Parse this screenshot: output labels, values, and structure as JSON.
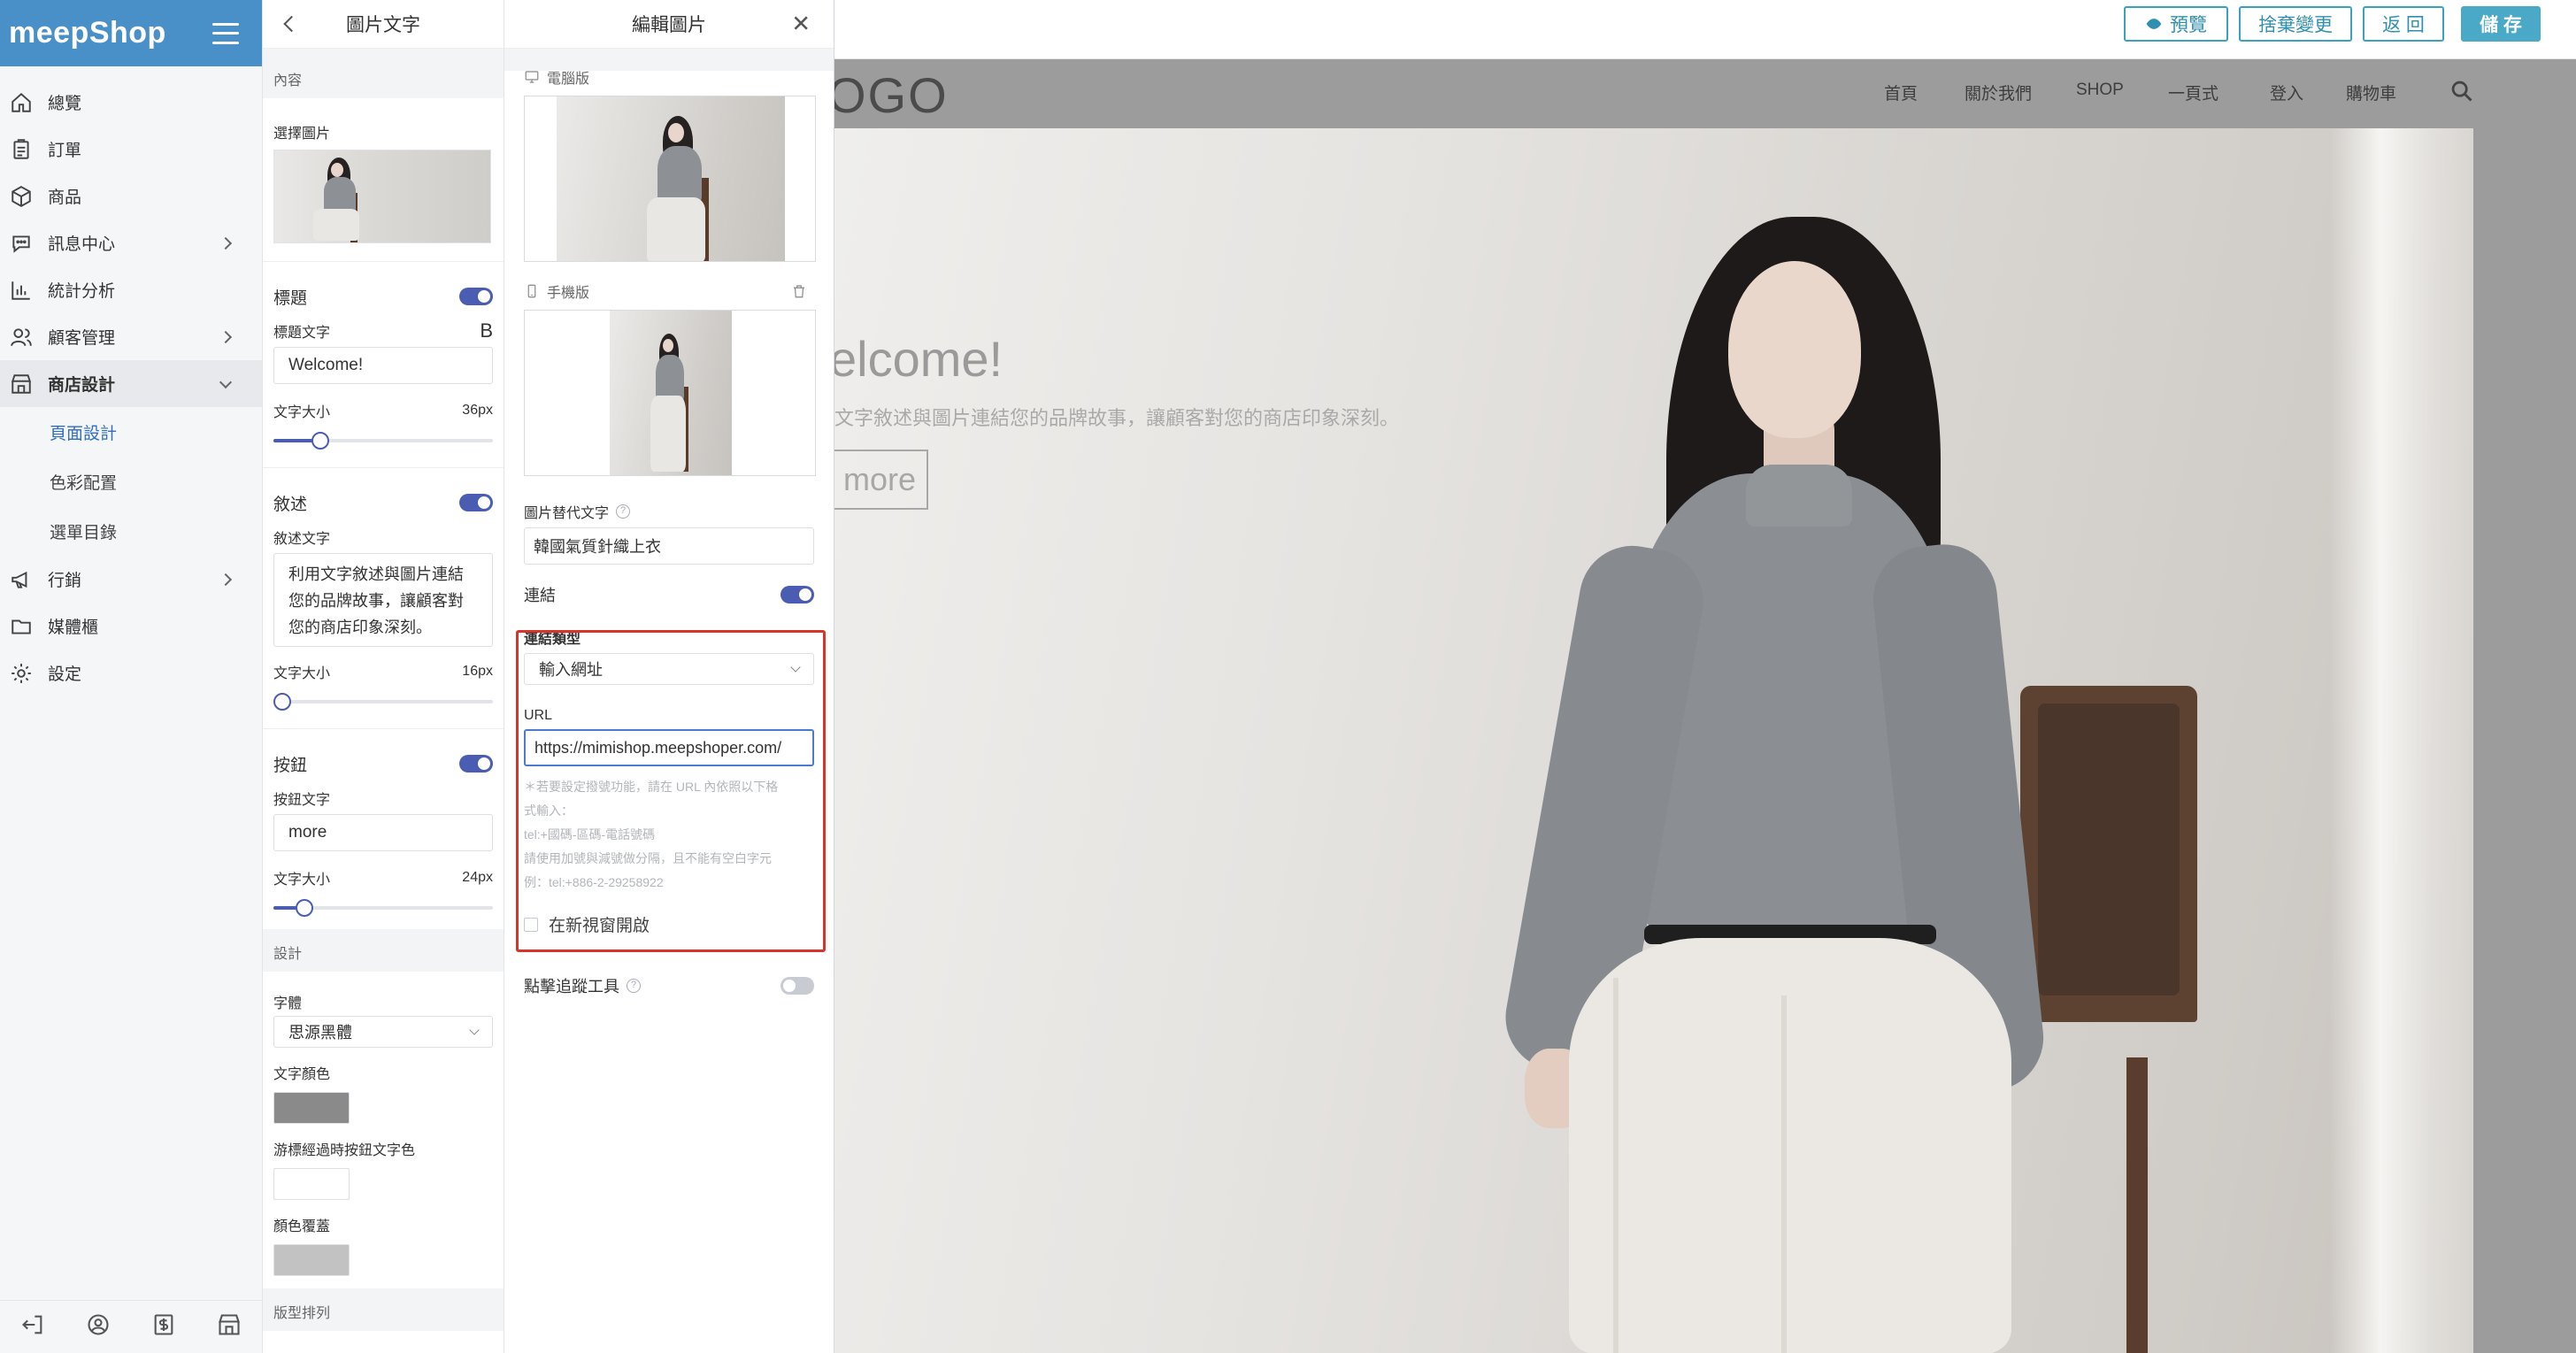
{
  "sidebar": {
    "brand": "meepShop",
    "items": [
      {
        "label": "總覽",
        "icon": "home-icon"
      },
      {
        "label": "訂單",
        "icon": "clipboard-icon"
      },
      {
        "label": "商品",
        "icon": "box-icon"
      },
      {
        "label": "訊息中心",
        "icon": "chat-icon"
      },
      {
        "label": "統計分析",
        "icon": "bar-chart-icon"
      },
      {
        "label": "顧客管理",
        "icon": "users-icon"
      },
      {
        "label": "商店設計",
        "icon": "store-icon"
      },
      {
        "label": "行銷",
        "icon": "megaphone-icon"
      },
      {
        "label": "媒體櫃",
        "icon": "folder-icon"
      },
      {
        "label": "設定",
        "icon": "gear-icon"
      }
    ],
    "subitems": [
      "頁面設計",
      "色彩配置",
      "選單目錄"
    ]
  },
  "settings": {
    "title": "圖片文字",
    "content_section": "內容",
    "select_image": "選擇圖片",
    "title_toggle": "標題",
    "title_text_label": "標題文字",
    "bold_label": "B",
    "title_value": "Welcome!",
    "font_size_label": "文字大小",
    "title_size": "36px",
    "title_size_fraction": 0.19,
    "desc_toggle": "敘述",
    "desc_text_label": "敘述文字",
    "desc_value": "利用文字敘述與圖片連結您的品牌故事，讓顧客對您的商店印象深刻。",
    "desc_size": "16px",
    "desc_size_fraction": 0.0,
    "button_toggle": "按鈕",
    "button_text_label": "按鈕文字",
    "button_value": "more",
    "button_size": "24px",
    "button_size_fraction": 0.11,
    "design_section": "設計",
    "font_label": "字體",
    "font_value": "思源黑體",
    "text_color_label": "文字顏色",
    "text_color": "#8a8a8a",
    "hover_color_label": "游標經過時按鈕文字色",
    "hover_color": "#ffffff",
    "overlay_label": "顏色覆蓋",
    "overlay_color": "#c2c2c2",
    "layout_section": "版型排列"
  },
  "edit_image": {
    "title": "編輯圖片",
    "desktop_label": "電腦版",
    "mobile_label": "手機版",
    "alt_label": "圖片替代文字",
    "alt_value": "韓國氣質針織上衣",
    "link_label": "連結",
    "link_type_label": "連結類型",
    "link_type_value": "輸入網址",
    "url_label": "URL",
    "url_value": "https://mimishop.meepshoper.com/",
    "hint_lines": [
      "＊若要設定撥號功能，請在 URL 內依照以下格",
      "式輸入：",
      "tel:+國碼-區碼-電話號碼",
      "請使用加號與減號做分隔，且不能有空白字元",
      "例：tel:+886-2-29258922"
    ],
    "new_window_label": "在新視窗開啟",
    "tracking_label": "點擊追蹤工具"
  },
  "topbar": {
    "preview": "預覽",
    "discard": "捨棄變更",
    "back": "返 回",
    "save": "儲 存"
  },
  "site": {
    "logo": "OGO",
    "nav": [
      "首頁",
      "關於我們",
      "SHOP",
      "一頁式",
      "登入",
      "購物車"
    ],
    "hero_title": "elcome!",
    "hero_desc": "文字敘述與圖片連結您的品牌故事，讓顧客對您的商店印象深刻。",
    "hero_button": "more"
  },
  "colors": {
    "brand": "#4a90c8",
    "accent": "#4b5db3",
    "topbar_accent": "#49a9c7",
    "highlight": "#d9342b"
  }
}
